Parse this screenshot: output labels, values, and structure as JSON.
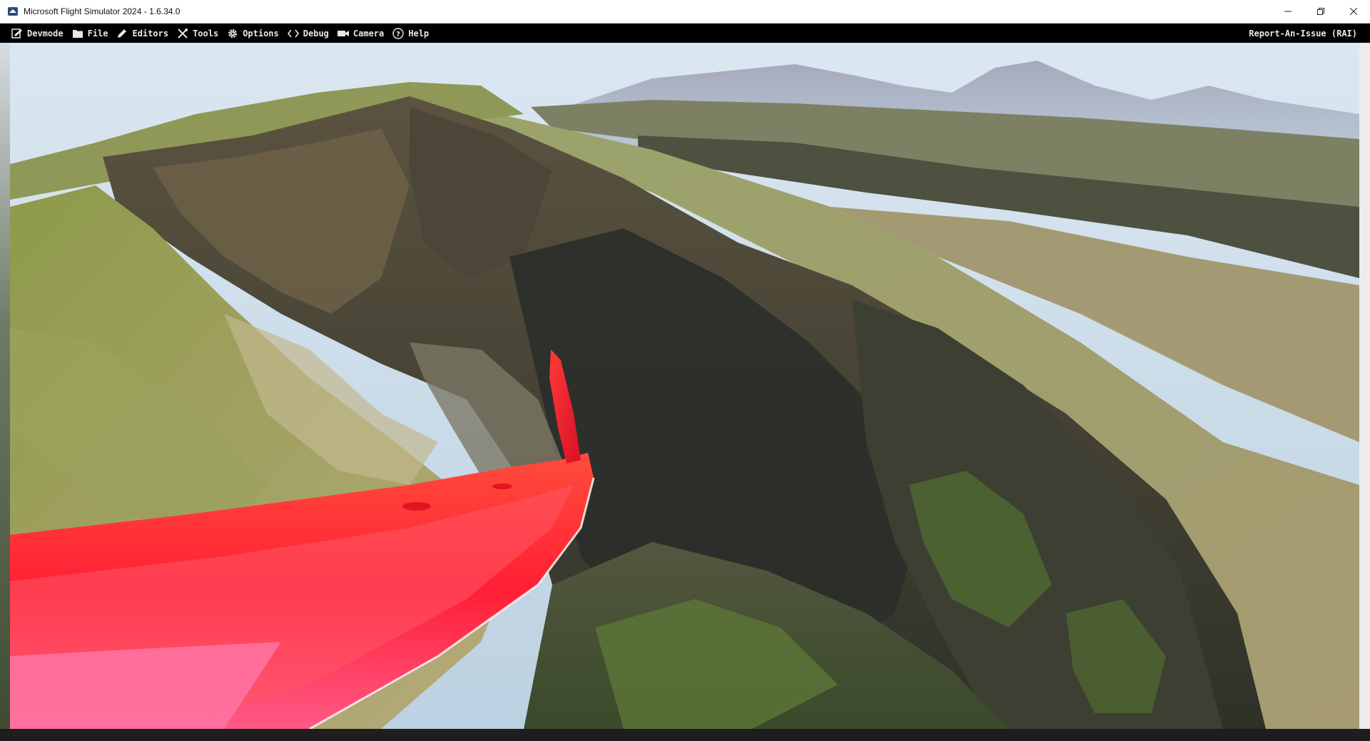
{
  "window": {
    "title": "Microsoft Flight Simulator 2024 - 1.6.34.0",
    "app_icon": "msfs-app-icon",
    "controls": [
      "minimize-icon",
      "restore-icon",
      "close-icon"
    ]
  },
  "menubar": {
    "items": [
      {
        "label": "Devmode",
        "icon": "devmode-icon"
      },
      {
        "label": "File",
        "icon": "folder-icon"
      },
      {
        "label": "Editors",
        "icon": "pencil-icon"
      },
      {
        "label": "Tools",
        "icon": "tools-icon"
      },
      {
        "label": "Options",
        "icon": "gear-icon"
      },
      {
        "label": "Debug",
        "icon": "code-brackets-icon"
      },
      {
        "label": "Camera",
        "icon": "camera-icon"
      },
      {
        "label": "Help",
        "icon": "help-circle-icon"
      }
    ],
    "report_issue": "Report-An-Issue (RAI)"
  },
  "scene": {
    "description_colors": {
      "sky": "#cfe0ee",
      "grass": "#8a9a4a",
      "cliff": "#4a4a3e",
      "wing": "#ff2a3a"
    }
  }
}
